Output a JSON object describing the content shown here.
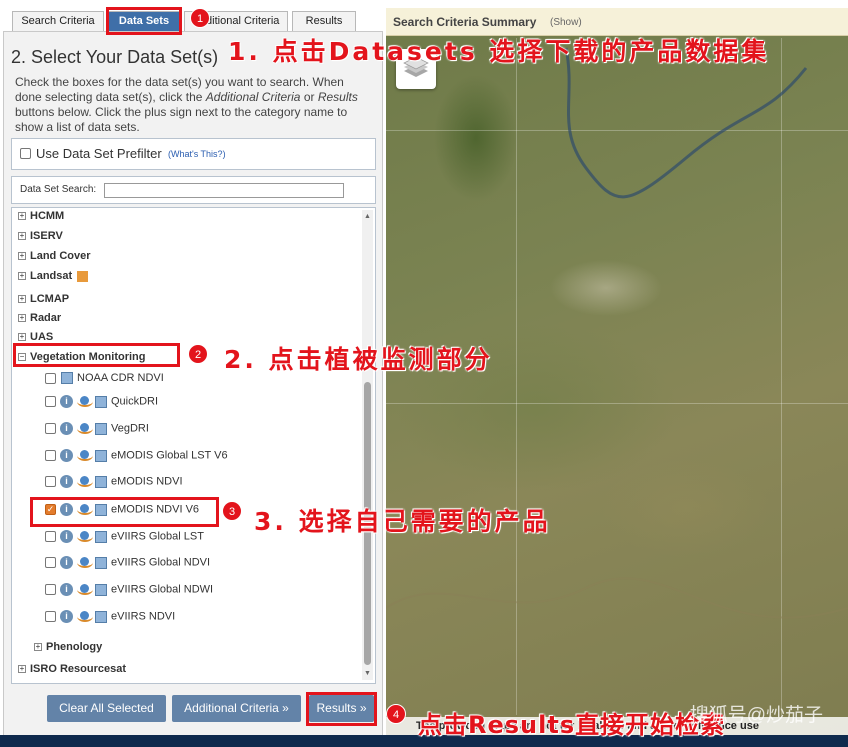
{
  "tabs": [
    "Search Criteria",
    "Data Sets",
    "Additional Criteria",
    "Results"
  ],
  "heading": "2. Select Your Data Set(s)",
  "intro": {
    "line1": "Check the boxes for the data set(s) you want to search. When",
    "line2a": "done selecting data set(s), click the ",
    "line2b": "Additional Criteria",
    "line2c": " or ",
    "line2d": "Results",
    "line3": "buttons below. Click the plus sign next to the category name to",
    "line4": "show a list of data sets."
  },
  "prefilter": {
    "label": "Use Data Set Prefilter",
    "help": "(What's This?)"
  },
  "search": {
    "label": "Data Set Search:",
    "value": ""
  },
  "categories": [
    "HCMM",
    "ISERV",
    "Land Cover",
    "Landsat",
    "LCMAP",
    "Radar",
    "UAS",
    "Vegetation Monitoring",
    "Phenology",
    "ISRO Resourcesat"
  ],
  "datasets": [
    "NOAA CDR NDVI",
    "QuickDRI",
    "VegDRI",
    "eMODIS Global LST V6",
    "eMODIS NDVI",
    "eMODIS NDVI V6",
    "eVIIRS Global LST",
    "eVIIRS Global NDVI",
    "eVIIRS Global NDWI",
    "eVIIRS NDVI"
  ],
  "buttons": {
    "clear": "Clear All Selected",
    "additional": "Additional Criteria »",
    "results": "Results »"
  },
  "map": {
    "summary_title": "Search Criteria Summary",
    "summary_show": "(Show)",
    "disclaimer": "The provided maps are not for legal use and are for reference use"
  },
  "annotations": {
    "a1": "1. 点击Datasets 选择下载的产品数据集",
    "a2": "2. 点击植被监测部分",
    "a3": "3. 选择自己需要的产品",
    "a4": "点击Results直接开始检索"
  },
  "badges": [
    "1",
    "2",
    "3",
    "4"
  ],
  "watermark": "搜狐号@炒茄子",
  "colors": {
    "accent": "#3f6fa8",
    "annotation": "#e3141c",
    "button": "#6383a8"
  }
}
